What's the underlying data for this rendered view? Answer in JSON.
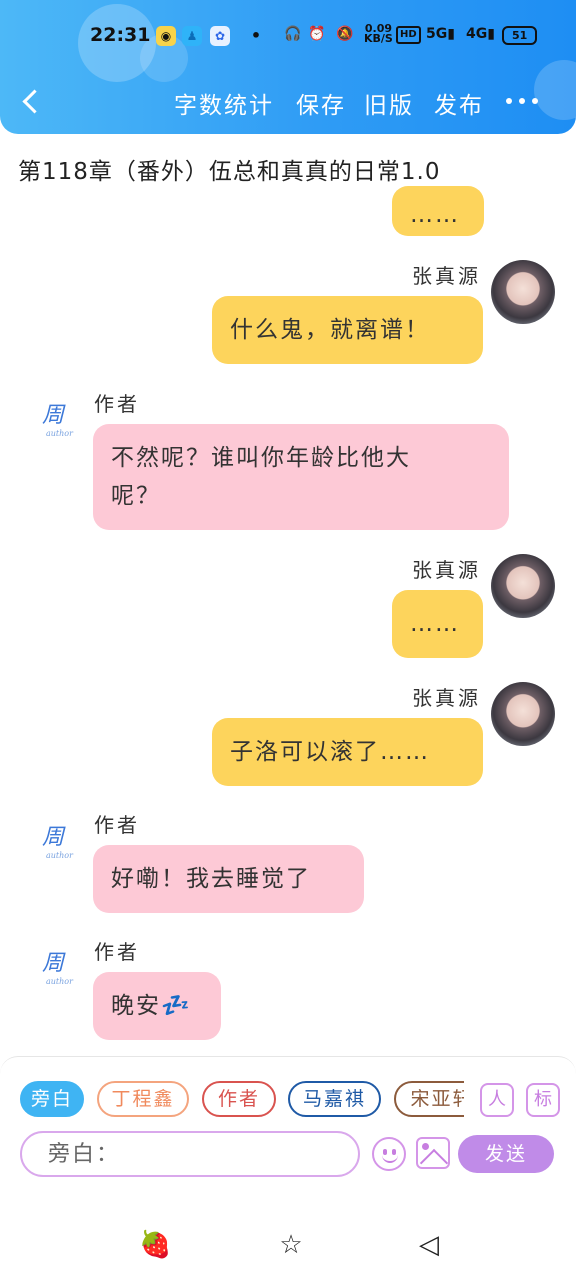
{
  "status_bar": {
    "time": "22:31",
    "apps": [
      "wechat-icon",
      "qq-icon",
      "baidu-icon"
    ],
    "dot": "•",
    "speed_value": "0.09",
    "speed_unit": "KB/S",
    "hd": "HD",
    "signal1": "5G",
    "signal2": "4G",
    "battery": "51"
  },
  "header": {
    "actions": {
      "word_count": "字数统计",
      "save": "保存",
      "old_version": "旧版",
      "publish": "发布"
    }
  },
  "chapter": {
    "title": "第118章（番外）伍总和真真的日常1.0"
  },
  "messages": [
    {
      "side": "right",
      "name": "",
      "text": "……"
    },
    {
      "side": "right",
      "name": "张真源",
      "text": "什么鬼，就离谱！"
    },
    {
      "side": "left",
      "name": "作者",
      "text": "不然呢？谁叫你年龄比他大",
      "text2": "呢？"
    },
    {
      "side": "right",
      "name": "张真源",
      "text": "……"
    },
    {
      "side": "right",
      "name": "张真源",
      "text": "子洛可以滚了……"
    },
    {
      "side": "left",
      "name": "作者",
      "text": "好嘞！我去睡觉了"
    },
    {
      "side": "left",
      "name": "作者",
      "text": "晚安💤"
    }
  ],
  "author_logo": {
    "mark": "周",
    "sub": "author"
  },
  "input_panel": {
    "roles": [
      {
        "label": "旁白",
        "color": "#3fb4f3",
        "filled": true
      },
      {
        "label": "丁程鑫",
        "color": "#f4a47e",
        "filled": false
      },
      {
        "label": "作者",
        "color": "#d9534f",
        "filled": false
      },
      {
        "label": "马嘉祺",
        "color": "#1f5aa6",
        "filled": false
      },
      {
        "label": "宋亚轩",
        "color": "#8c5b3c",
        "filled": false
      }
    ],
    "tool_person": "人",
    "tool_tag": "标",
    "input_placeholder": "旁白：",
    "send_label": "发送"
  },
  "bottom_nav": {
    "icons": [
      "strawberry-icon",
      "star-icon",
      "back-shape-icon"
    ],
    "strawberry": "🍓",
    "star": "☆",
    "back": "◁"
  },
  "colors": {
    "header": "#2f9cf5",
    "bubble_right": "#fdd45c",
    "bubble_left": "#fdc9d6",
    "send": "#c08be8"
  }
}
